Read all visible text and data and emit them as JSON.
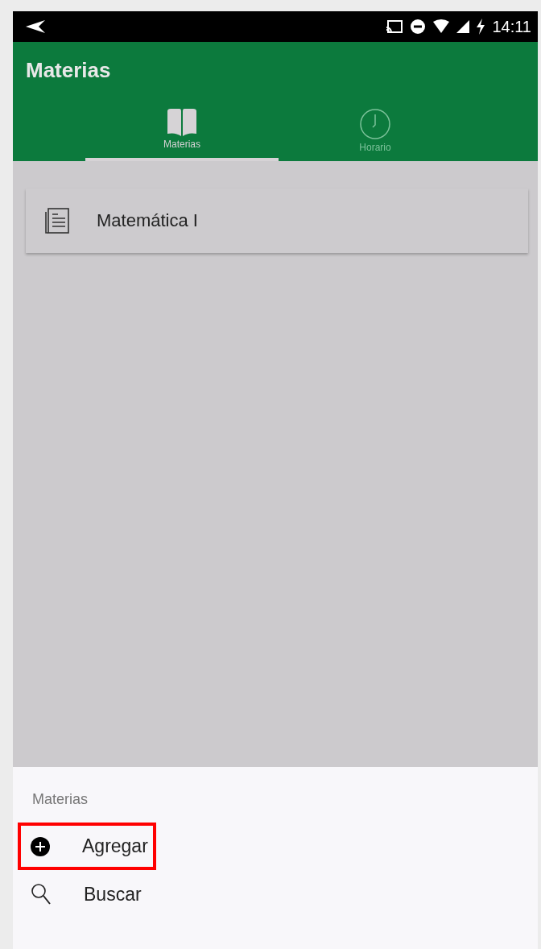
{
  "status_bar": {
    "time": "14:11"
  },
  "app_bar": {
    "title": "Materias"
  },
  "tabs": [
    {
      "label": "Materias",
      "kind": "book",
      "selected": true
    },
    {
      "label": "Horario",
      "kind": "clock",
      "selected": false
    }
  ],
  "list": [
    {
      "label": "Matemática I"
    }
  ],
  "bottom_sheet": {
    "title": "Materias",
    "items": [
      {
        "label": "Agregar",
        "kind": "add",
        "highlighted": true
      },
      {
        "label": "Buscar",
        "kind": "search",
        "highlighted": false
      }
    ]
  }
}
